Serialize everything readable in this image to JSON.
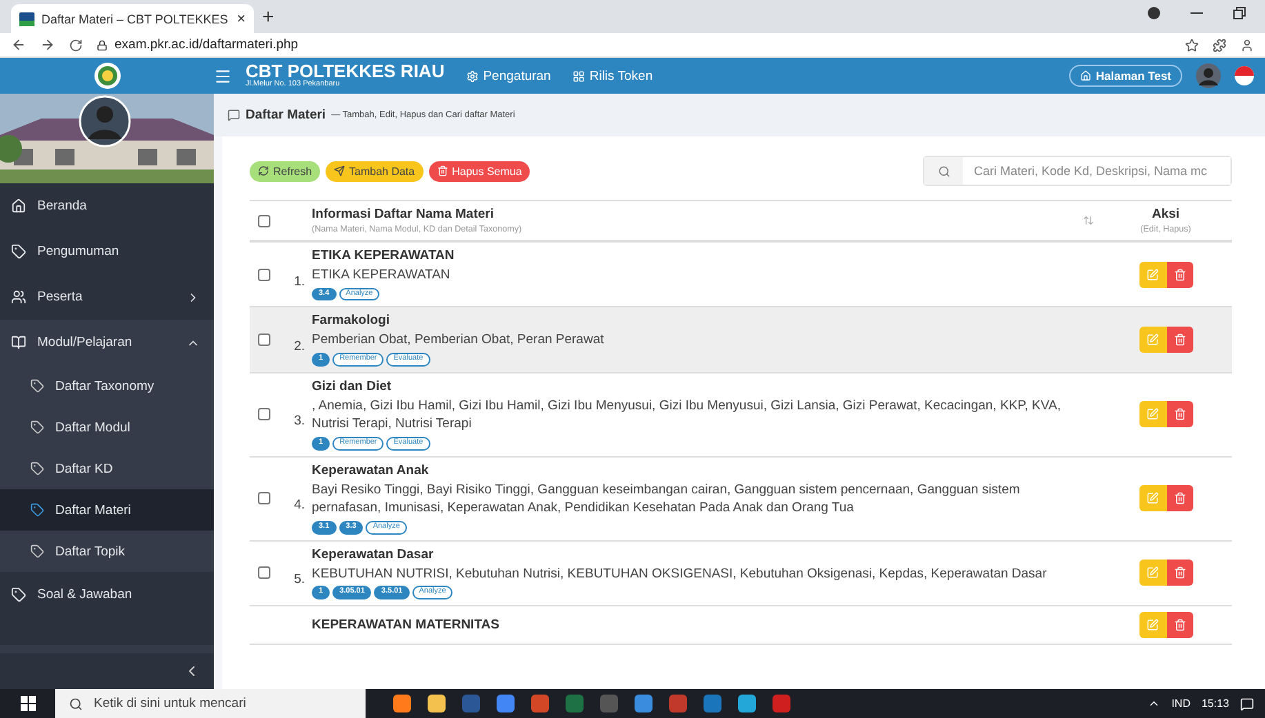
{
  "browser": {
    "tab_title": "Daftar Materi – CBT POLTEKKES",
    "tab_close": "×",
    "new_tab": "+",
    "url": "exam.pkr.ac.id/daftarmateri.php"
  },
  "header": {
    "title": "CBT POLTEKKES RIAU",
    "address": "Jl.Melur No. 103 Pekanbaru",
    "menu": [
      {
        "label": "Pengaturan",
        "kind": "gear"
      },
      {
        "label": "Rilis Token",
        "kind": "grid"
      }
    ],
    "test_button": "Halaman Test"
  },
  "sidebar": {
    "items": [
      {
        "label": "Beranda",
        "kind": "home",
        "selected": false
      },
      {
        "label": "Pengumuman",
        "kind": "tag",
        "selected": false
      },
      {
        "label": "Peserta",
        "kind": "people",
        "selected": false,
        "expanded": false
      },
      {
        "label": "Modul/Pelajaran",
        "kind": "book",
        "selected": false,
        "expanded": true,
        "children": [
          {
            "label": "Daftar Taxonomy",
            "selected": false
          },
          {
            "label": "Daftar Modul",
            "selected": false
          },
          {
            "label": "Daftar KD",
            "selected": false
          },
          {
            "label": "Daftar Materi",
            "selected": true
          },
          {
            "label": "Daftar Topik",
            "selected": false
          }
        ]
      },
      {
        "label": "Soal & Jawaban",
        "kind": "tag",
        "selected": false
      }
    ]
  },
  "page": {
    "title": "Daftar Materi",
    "subtitle": "— Tambah, Edit, Hapus dan Cari daftar Materi",
    "buttons": [
      {
        "label": "Refresh",
        "kind": "refresh"
      },
      {
        "label": "Tambah Data",
        "kind": "add"
      },
      {
        "label": "Hapus Semua",
        "kind": "delete"
      }
    ],
    "search": {
      "placeholder": "Cari Materi, Kode Kd, Deskripsi, Nama mc"
    }
  },
  "table": {
    "header": {
      "title": "Informasi Daftar Nama Materi",
      "note": "(Nama Materi, Nama Modul, KD dan Detail Taxonomy)",
      "action_title": "Aksi",
      "action_note": "(Edit, Hapus)",
      "checked": false
    },
    "rows": [
      {
        "number": "1.",
        "title": "ETIKA KEPERAWATAN",
        "text": "ETIKA KEPERAWATAN",
        "checked": false,
        "highlighted": false,
        "tags": [
          {
            "label": "3.4",
            "kind": "filled"
          },
          {
            "label": "Analyze",
            "kind": "outline"
          }
        ]
      },
      {
        "number": "2.",
        "title": "Farmakologi",
        "text": "Pemberian Obat, Pemberian Obat, Peran Perawat",
        "checked": false,
        "highlighted": true,
        "tags": [
          {
            "label": "1",
            "kind": "filled"
          },
          {
            "label": "Remember",
            "kind": "outline"
          },
          {
            "label": "Evaluate",
            "kind": "outline"
          }
        ]
      },
      {
        "number": "3.",
        "title": "Gizi dan Diet",
        "text": ", Anemia, Gizi Ibu Hamil, Gizi Ibu Hamil, Gizi Ibu Menyusui, Gizi Ibu Menyusui, Gizi Lansia, Gizi Perawat, Kecacingan, KKP, KVA, Nutrisi Terapi, Nutrisi Terapi",
        "checked": false,
        "highlighted": false,
        "tags": [
          {
            "label": "1",
            "kind": "filled"
          },
          {
            "label": "Remember",
            "kind": "outline"
          },
          {
            "label": "Evaluate",
            "kind": "outline"
          }
        ]
      },
      {
        "number": "4.",
        "title": "Keperawatan Anak",
        "text": "Bayi Resiko Tinggi, Bayi Risiko Tinggi, Gangguan keseimbangan cairan, Gangguan sistem pencernaan, Gangguan sistem pernafasan, Imunisasi, Keperawatan Anak, Pendidikan Kesehatan Pada Anak dan Orang Tua",
        "checked": false,
        "highlighted": false,
        "tags": [
          {
            "label": "3.1",
            "kind": "filled"
          },
          {
            "label": "3.3",
            "kind": "filled"
          },
          {
            "label": "Analyze",
            "kind": "outline"
          }
        ]
      },
      {
        "number": "5.",
        "title": "Keperawatan Dasar",
        "text": "KEBUTUHAN NUTRISI, Kebutuhan Nutrisi, KEBUTUHAN OKSIGENASI, Kebutuhan Oksigenasi, Kepdas, Keperawatan Dasar",
        "checked": false,
        "highlighted": false,
        "tags": [
          {
            "label": "1",
            "kind": "filled"
          },
          {
            "label": "3.05.01",
            "kind": "filled"
          },
          {
            "label": "3.5.01",
            "kind": "filled"
          },
          {
            "label": "Analyze",
            "kind": "outline"
          }
        ]
      },
      {
        "title": "KEPERAWATAN MATERNITAS",
        "highlighted": false
      }
    ]
  },
  "taskbar": {
    "search_placeholder": "Ketik di sini untuk mencari",
    "language": "IND",
    "time": "15:13"
  }
}
